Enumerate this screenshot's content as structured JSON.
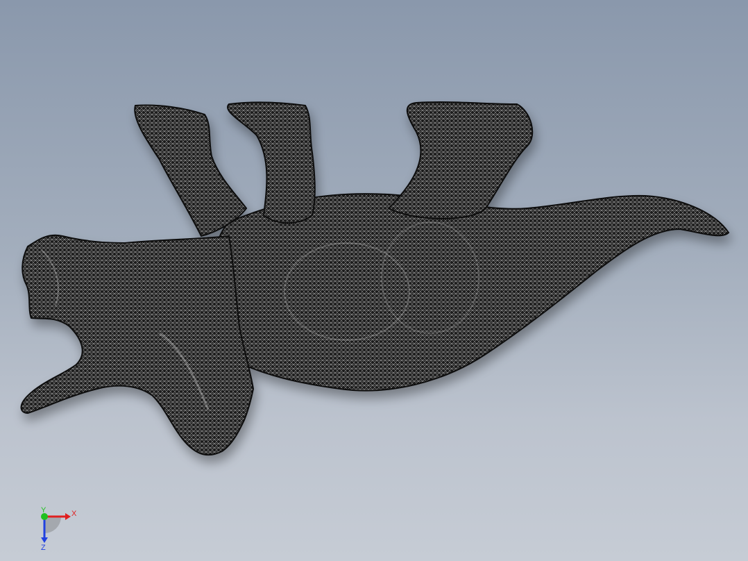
{
  "viewport": {
    "background_top": "#8a98ac",
    "background_bottom": "#c6ccd5",
    "mesh_color": "#1a1a1a",
    "mesh_highlight": "#e8e8e8"
  },
  "model": {
    "icon": "triceratops-mesh-model"
  },
  "triad": {
    "x_label": "X",
    "y_label": "Y",
    "z_label": "Z",
    "x_color": "#e02020",
    "y_color": "#20c020",
    "z_color": "#2040e0"
  }
}
